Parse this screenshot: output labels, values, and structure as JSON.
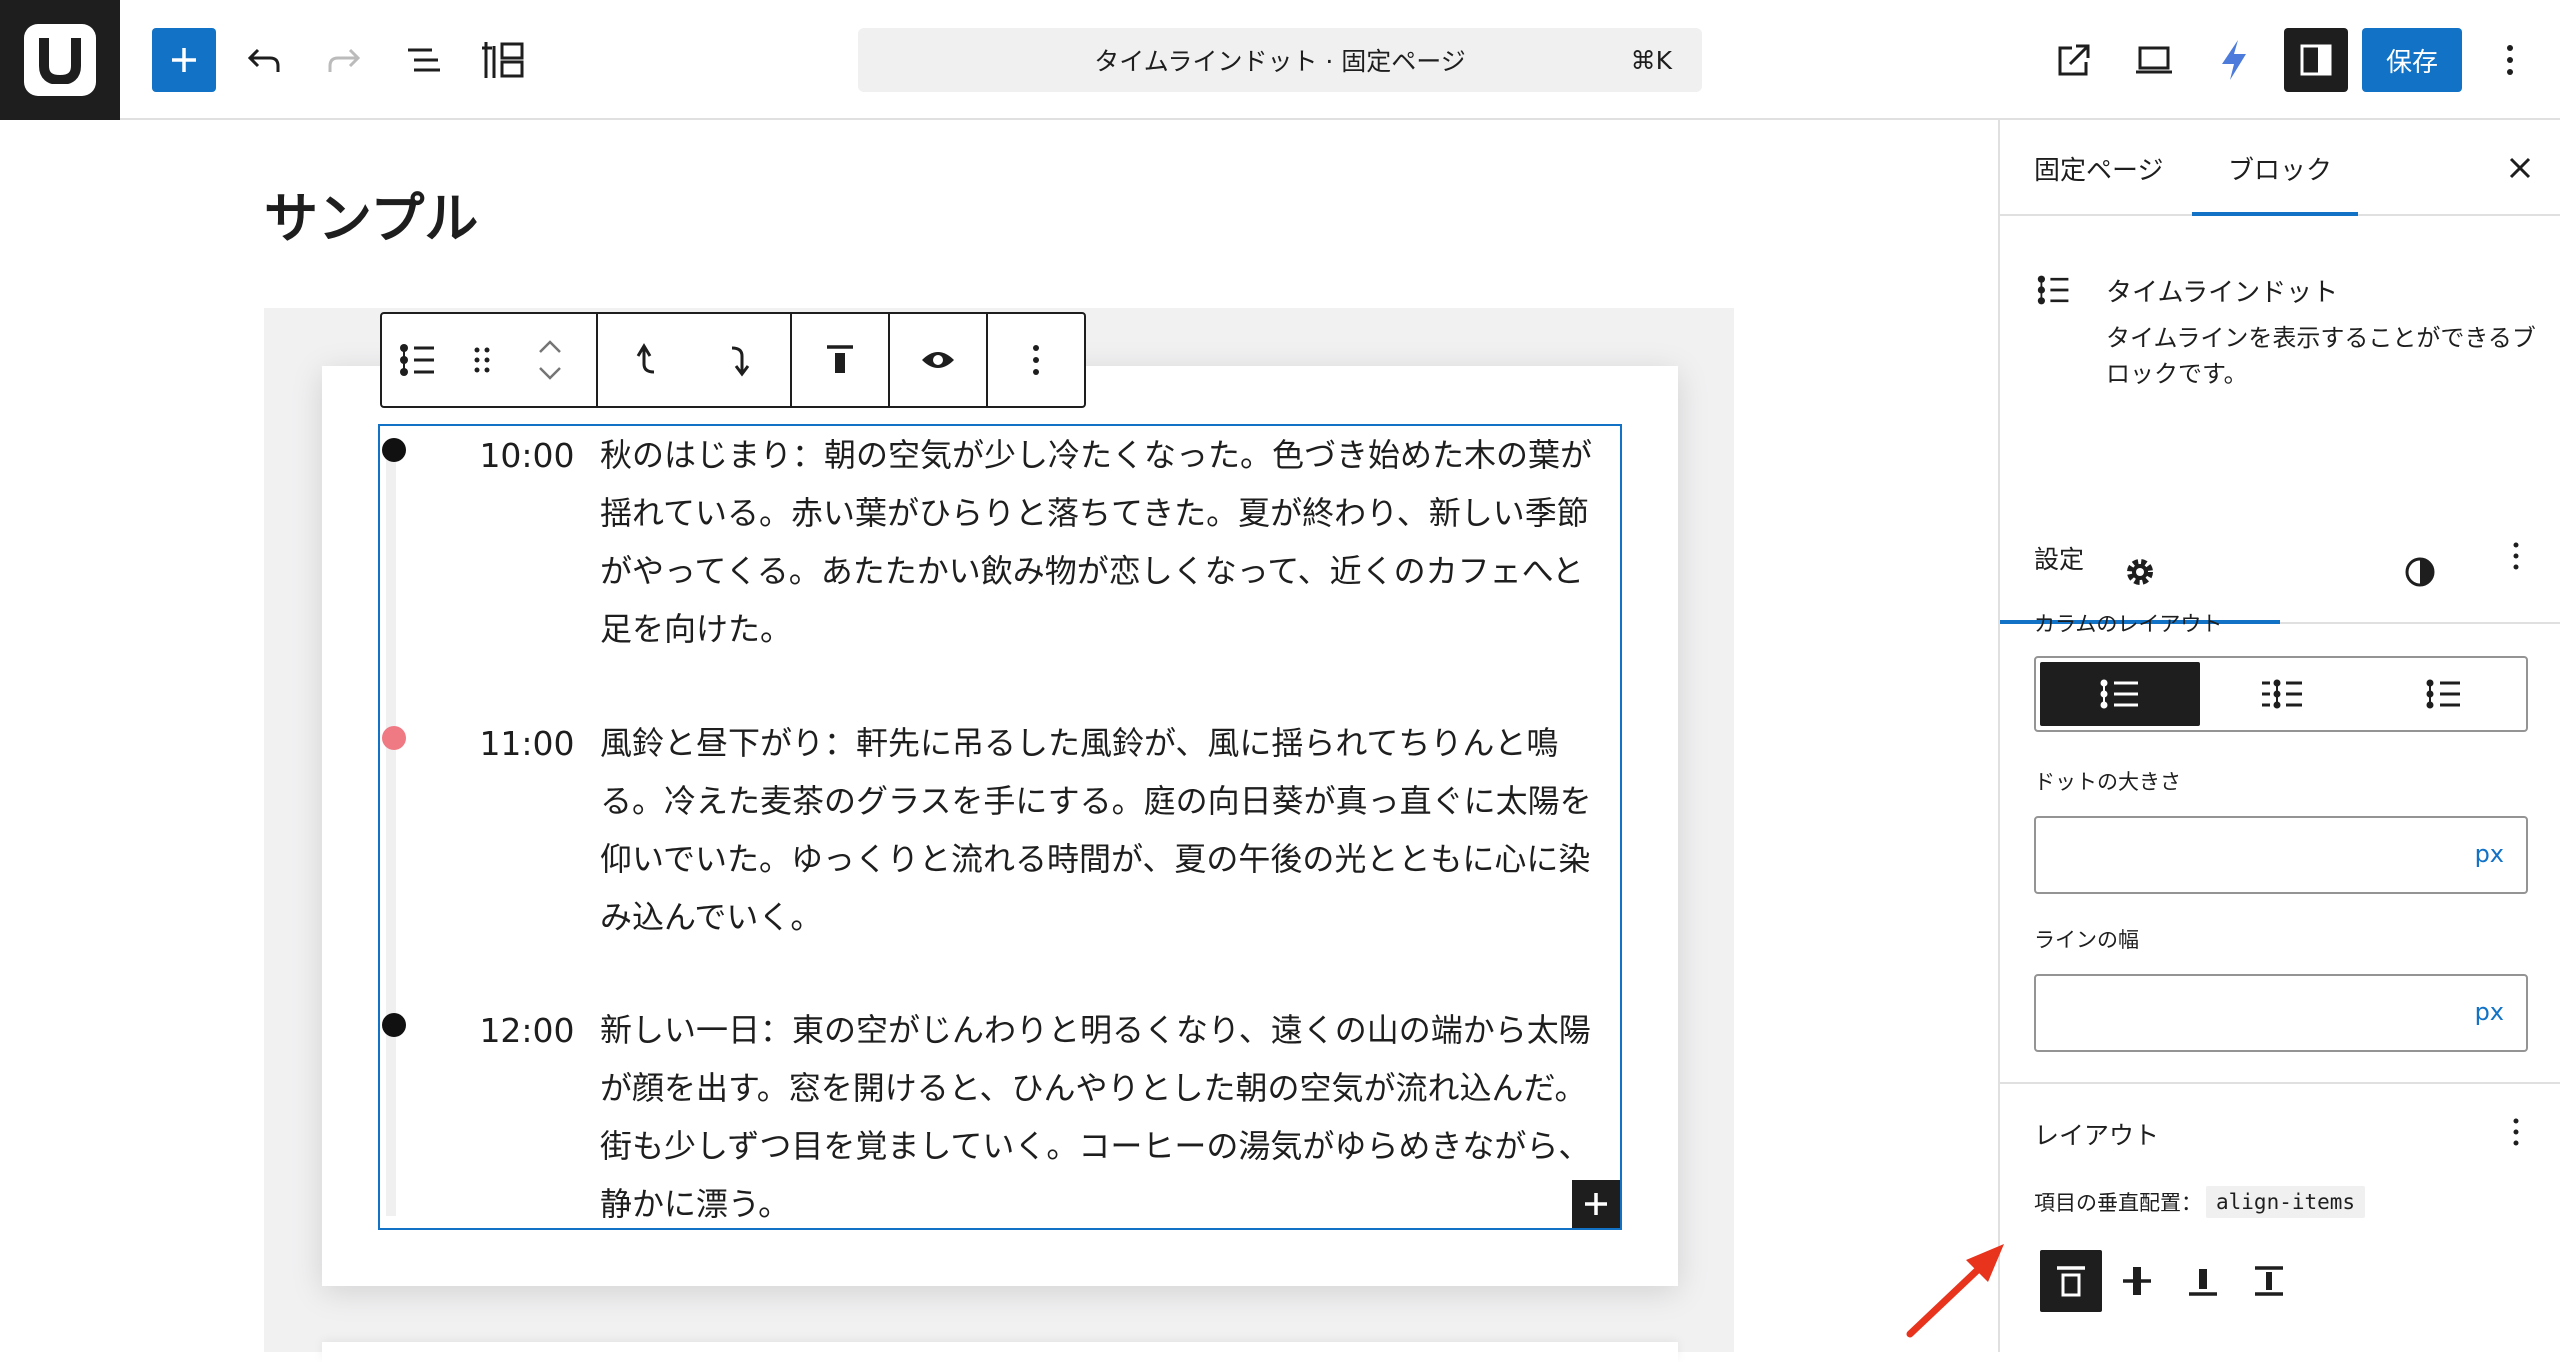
{
  "topbar": {
    "command_title": "タイムラインドット · 固定ページ",
    "command_shortcut": "⌘K",
    "save_label": "保存"
  },
  "editor": {
    "post_title": "サンプル"
  },
  "timeline": {
    "items": [
      {
        "time": "10:00",
        "dot_color": "#111111",
        "text": "秋のはじまり：朝の空気が少し冷たくなった。色づき始めた木の葉が揺れている。赤い葉がひらりと落ちてきた。夏が終わり、新しい季節がやってくる。あたたかい飲み物が恋しくなって、近くのカフェへと足を向けた。"
      },
      {
        "time": "11:00",
        "dot_color": "#f07a84",
        "text": "風鈴と昼下がり：軒先に吊るした風鈴が、風に揺られてちりんと鳴る。冷えた麦茶のグラスを手にする。庭の向日葵が真っ直ぐに太陽を仰いでいた。ゆっくりと流れる時間が、夏の午後の光とともに心に染み込んでいく。"
      },
      {
        "time": "12:00",
        "dot_color": "#111111",
        "text": "新しい一日：東の空がじんわりと明るくなり、遠くの山の端から太陽が顔を出す。窓を開けると、ひんやりとした朝の空気が流れ込んだ。街も少しずつ目を覚ましていく。コーヒーの湯気がゆらめきながら、静かに漂う。"
      }
    ]
  },
  "sidebar": {
    "tabs": [
      "固定ページ",
      "ブロック"
    ],
    "block_name": "タイムラインドット",
    "block_description": "タイムラインを表示することができるブロックです。",
    "settings_title": "設定",
    "column_layout_label": "カラムのレイアウト",
    "dot_size_label": "ドットの大きさ",
    "dot_size_unit": "px",
    "line_width_label": "ラインの幅",
    "line_width_unit": "px",
    "layout_title": "レイアウト",
    "vertical_align_label": "項目の垂直配置：",
    "vertical_align_code": "align-items"
  },
  "colors": {
    "accent": "#1172c6",
    "dark": "#1e1e1e",
    "dot_highlight": "#f07a84",
    "annotation_arrow": "#e8331d"
  }
}
